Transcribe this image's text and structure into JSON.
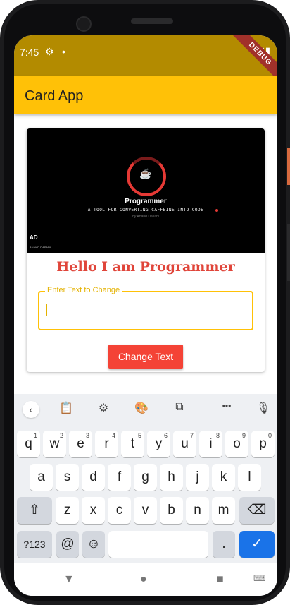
{
  "status_bar": {
    "time": "7:45",
    "gear": "⚙",
    "dot": "•",
    "signal": "▾◢▮",
    "debug_ribbon": "DEBUG"
  },
  "app_bar": {
    "title": "Card App"
  },
  "card": {
    "banner": {
      "title": "Programmer",
      "subtitle": "A TOOL FOR CONVERTING CAFFEINE INTO CODE",
      "byline": "by Anand Dasani",
      "logo_text": "AD",
      "logo_caption": "ANAND DASANI",
      "cup": "☕"
    },
    "heading": "Hello I am Programmer",
    "input": {
      "label": "Enter Text to Change",
      "value": ""
    },
    "button": "Change Text"
  },
  "keyboard": {
    "toolbar": {
      "back": "‹",
      "clipboard": "📋",
      "settings": "⚙",
      "theme": "🎨",
      "resize": "⧉",
      "more": "•••",
      "mic_off": "🎙"
    },
    "row1": [
      {
        "k": "q",
        "n": "1"
      },
      {
        "k": "w",
        "n": "2"
      },
      {
        "k": "e",
        "n": "3"
      },
      {
        "k": "r",
        "n": "4"
      },
      {
        "k": "t",
        "n": "5"
      },
      {
        "k": "y",
        "n": "6"
      },
      {
        "k": "u",
        "n": "7"
      },
      {
        "k": "i",
        "n": "8"
      },
      {
        "k": "o",
        "n": "9"
      },
      {
        "k": "p",
        "n": "0"
      }
    ],
    "row2": [
      "a",
      "s",
      "d",
      "f",
      "g",
      "h",
      "j",
      "k",
      "l"
    ],
    "row3": [
      "z",
      "x",
      "c",
      "v",
      "b",
      "n",
      "m"
    ],
    "shift": "⇧",
    "backspace": "⌫",
    "symbols": "?123",
    "at": "@",
    "emoji": "☺",
    "period": ".",
    "enter": "✓"
  },
  "nav_bar": {
    "back": "▼",
    "home": "●",
    "recents": "■",
    "keyboard_switch": "⌨"
  }
}
